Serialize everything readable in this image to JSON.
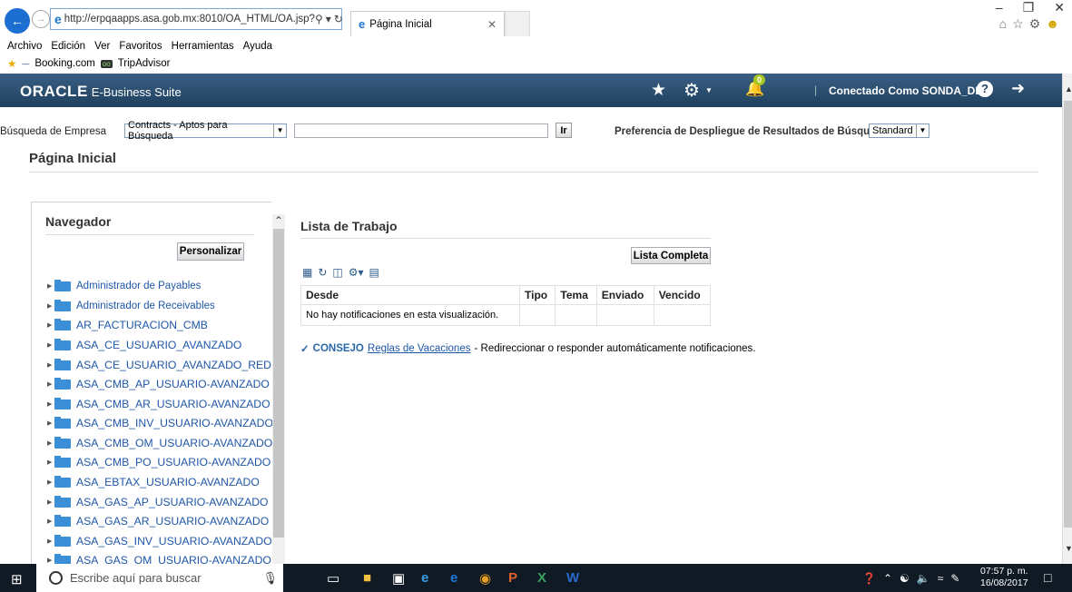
{
  "browser": {
    "url": "http://erpqaapps.asa.gob.mx:8010/OA_HTML/OA.jsp?",
    "tab_title": "Página Inicial",
    "menu": [
      "Archivo",
      "Edición",
      "Ver",
      "Favoritos",
      "Herramientas",
      "Ayuda"
    ],
    "favorites": [
      "Booking.com",
      "TripAdvisor"
    ]
  },
  "header": {
    "logo": "ORACLE",
    "product": "E-Business Suite",
    "notification_count": "0",
    "user_label": "Conectado Como SONDA_DEV"
  },
  "search": {
    "label": "Búsqueda de Empresa",
    "selected": "Contracts - Aptos para Búsqueda",
    "go_label": "Ir",
    "pref_label": "Preferencia de Despliegue de Resultados de Búsqueda",
    "pref_selected": "Standard"
  },
  "page": {
    "title": "Página Inicial"
  },
  "navigator": {
    "title": "Navegador",
    "personalize_label": "Personalizar",
    "items": [
      "Administrador de Payables",
      "Administrador de Receivables",
      "AR_FACTURACION_CMB",
      "ASA_CE_USUARIO_AVANZADO",
      "ASA_CE_USUARIO_AVANZADO_RED",
      "ASA_CMB_AP_USUARIO-AVANZADO",
      "ASA_CMB_AR_USUARIO-AVANZADO",
      "ASA_CMB_INV_USUARIO-AVANZADO",
      "ASA_CMB_OM_USUARIO-AVANZADO",
      "ASA_CMB_PO_USUARIO-AVANZADO",
      "ASA_EBTAX_USUARIO-AVANZADO",
      "ASA_GAS_AP_USUARIO-AVANZADO",
      "ASA_GAS_AR_USUARIO-AVANZADO",
      "ASA_GAS_INV_USUARIO-AVANZADO",
      "ASA_GAS_OM_USUARIO-AVANZADO"
    ]
  },
  "worklist": {
    "title": "Lista de Trabajo",
    "full_list_label": "Lista Completa",
    "columns": [
      "Desde",
      "Tipo",
      "Tema",
      "Enviado",
      "Vencido"
    ],
    "empty_message": "No hay notificaciones en esta visualización.",
    "tip_label": "CONSEJO",
    "tip_link": "Reglas de Vacaciones",
    "tip_text": "- Redireccionar o responder automáticamente notificaciones."
  },
  "taskbar": {
    "search_placeholder": "Escribe aquí para buscar",
    "time": "07:57 p. m.",
    "date": "16/08/2017"
  }
}
